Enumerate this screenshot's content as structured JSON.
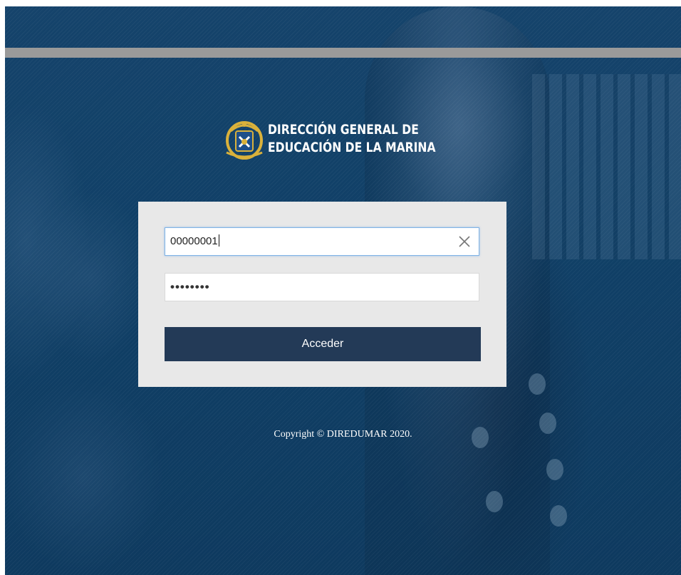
{
  "branding": {
    "title_line1": "DIRECCIÓN GENERAL DE",
    "title_line2": "EDUCACIÓN DE LA MARINA",
    "emblem_icon": "naval-crest-icon"
  },
  "login": {
    "username_value": "00000001",
    "password_mask": "••••••••",
    "clear_icon": "close-icon",
    "submit_label": "Acceder"
  },
  "footer": {
    "copyright": "Copyright © DIREDUMAR 2020."
  },
  "colors": {
    "background_blue": "#104067",
    "card": "#e8e8e8",
    "button": "#233a57",
    "logo_gold": "#d9b13b"
  }
}
